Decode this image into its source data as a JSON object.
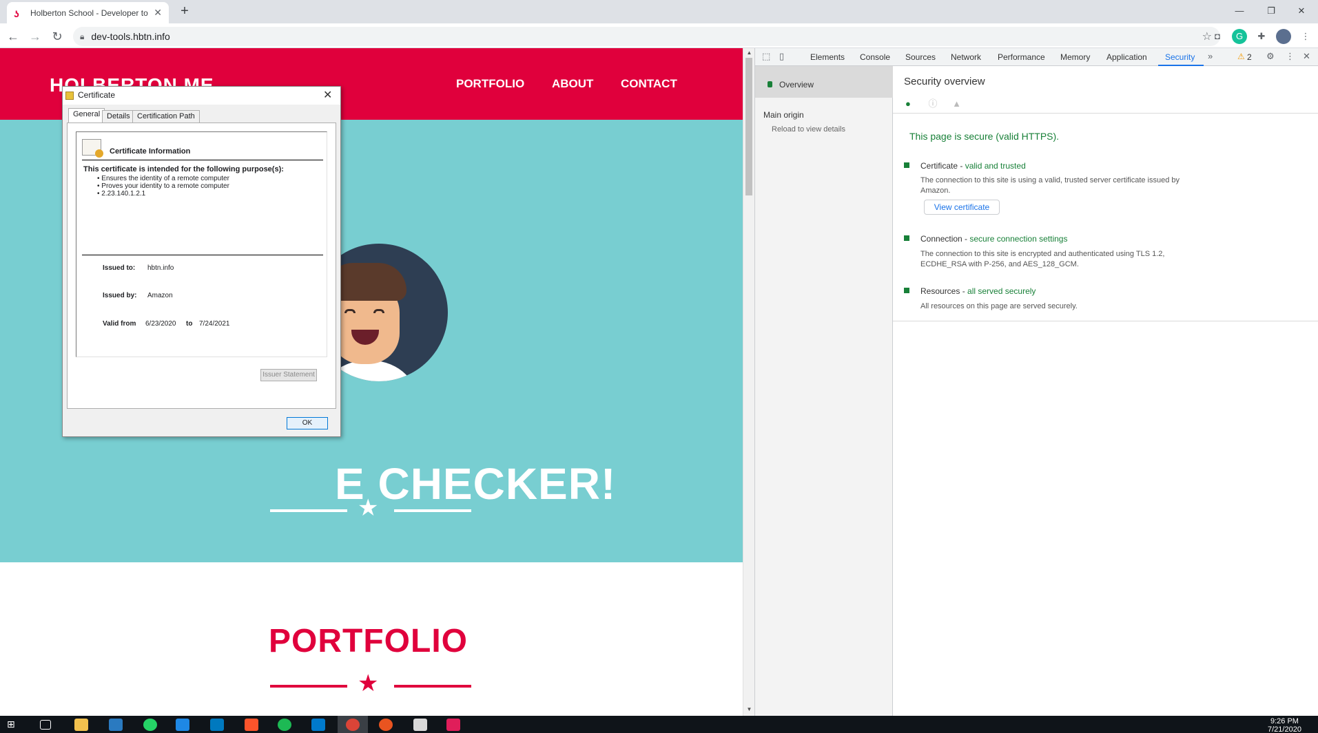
{
  "browser": {
    "tab_title": "Holberton School - Developer to",
    "url": "dev-tools.hbtn.info"
  },
  "site": {
    "logo": "HOLBERTON ME",
    "nav": [
      "PORTFOLIO",
      "ABOUT",
      "CONTACT"
    ],
    "hero_title": "E CHECKER!",
    "portfolio_title": "PORTFOLIO"
  },
  "devtools": {
    "tabs": [
      "Elements",
      "Console",
      "Sources",
      "Network",
      "Performance",
      "Memory",
      "Application",
      "Security"
    ],
    "active_tab": "Security",
    "warning_count": "2",
    "sidebar": {
      "overview": "Overview",
      "main_origin": "Main origin",
      "reload": "Reload to view details"
    },
    "security": {
      "heading": "Security overview",
      "status": "This page is secure (valid HTTPS).",
      "items": [
        {
          "label": "Certificate - ",
          "status": "valid and trusted",
          "desc": "The connection to this site is using a valid, trusted server certificate issued by Amazon."
        },
        {
          "label": "Connection - ",
          "status": "secure connection settings",
          "desc": "The connection to this site is encrypted and authenticated using TLS 1.2, ECDHE_RSA with P-256, and AES_128_GCM."
        },
        {
          "label": "Resources - ",
          "status": "all served securely",
          "desc": "All resources on this page are served securely."
        }
      ],
      "view_cert": "View certificate"
    },
    "colors": {
      "secure": "#188038",
      "active_tab": "#1a73e8"
    }
  },
  "certificate": {
    "title": "Certificate",
    "tabs": [
      "General",
      "Details",
      "Certification Path"
    ],
    "heading": "Certificate Information",
    "purpose_heading": "This certificate is intended for the following purpose(s):",
    "purposes": [
      "Ensures the identity of a remote computer",
      "Proves your identity to a remote computer",
      "2.23.140.1.2.1"
    ],
    "issued_to_label": "Issued to:",
    "issued_to": "hbtn.info",
    "issued_by_label": "Issued by:",
    "issued_by": "Amazon",
    "valid_from_label": "Valid from",
    "valid_from": "6/23/2020",
    "to_label": "to",
    "valid_to": "7/24/2021",
    "issuer_statement": "Issuer Statement",
    "ok": "OK"
  },
  "taskbar": {
    "time": "9:26 PM",
    "date": "7/21/2020"
  },
  "theme": {
    "brand_red": "#e0003c",
    "hero_teal": "#78ced1"
  }
}
